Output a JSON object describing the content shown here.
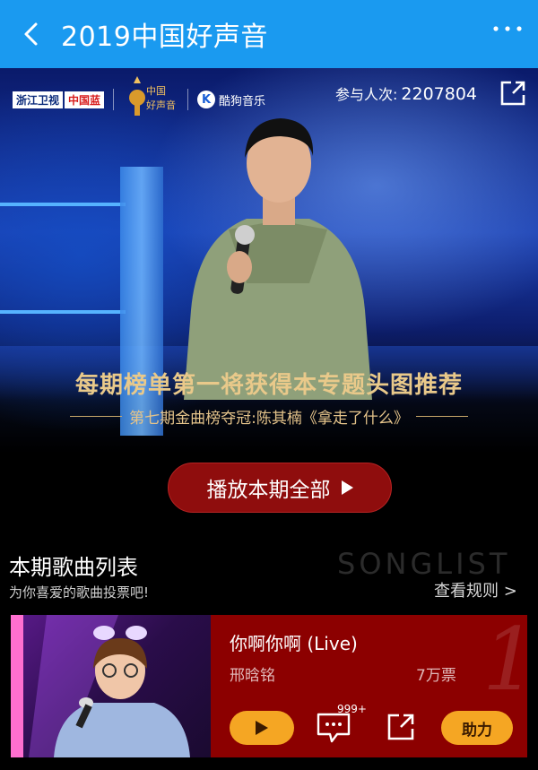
{
  "header": {
    "title": "2019中国好声音",
    "back_icon": "back-arrow-icon",
    "more_icon": "more-dots-icon"
  },
  "hero": {
    "logos": {
      "zjtv": "浙江卫视",
      "zglan": "中国蓝",
      "voice_line1": "中国",
      "voice_line2": "好声音",
      "kugou": "酷狗音乐",
      "kugou_k": "K"
    },
    "participants_label": "参与人次:",
    "participants_count": "2207804",
    "headline": "每期榜单第一将获得本专题头图推荐",
    "subline": "第七期金曲榜夺冠:陈其楠《拿走了什么》",
    "play_all": "播放本期全部"
  },
  "songlist": {
    "title": "本期歌曲列表",
    "subtitle": "为你喜爱的歌曲投票吧!",
    "watermark": "SONGLIST",
    "rules_link": "查看规则 >"
  },
  "songs": [
    {
      "rank": "1",
      "title": "你啊你啊 (Live)",
      "artist": "邢晗铭",
      "votes": "7万票",
      "comments_badge": "999+",
      "help_label": "助力"
    }
  ],
  "colors": {
    "appbar": "#1a9af0",
    "accent_gold": "#e9c98a",
    "card_red": "#8c0000",
    "button_orange": "#f5a623"
  }
}
